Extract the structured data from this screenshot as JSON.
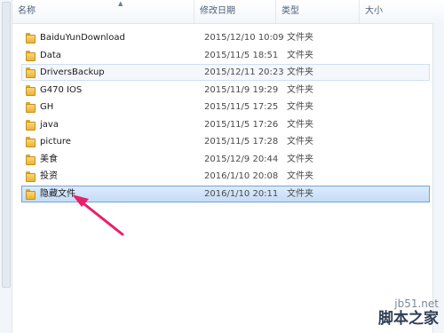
{
  "columns": {
    "name": "名称",
    "date": "修改日期",
    "type": "类型",
    "size": "大小"
  },
  "rows": [
    {
      "name": "BaiduYunDownload",
      "date": "2015/12/10 10:09",
      "type": "文件夹"
    },
    {
      "name": "Data",
      "date": "2015/11/5 18:51",
      "type": "文件夹"
    },
    {
      "name": "DriversBackup",
      "date": "2015/12/11 20:23",
      "type": "文件夹"
    },
    {
      "name": "G470 IOS",
      "date": "2015/11/9 19:29",
      "type": "文件夹"
    },
    {
      "name": "GH",
      "date": "2015/11/5 17:25",
      "type": "文件夹"
    },
    {
      "name": "java",
      "date": "2015/11/5 17:26",
      "type": "文件夹"
    },
    {
      "name": "picture",
      "date": "2015/11/5 17:28",
      "type": "文件夹"
    },
    {
      "name": "美食",
      "date": "2015/12/9 20:44",
      "type": "文件夹"
    },
    {
      "name": "投资",
      "date": "2016/1/10 20:08",
      "type": "文件夹"
    },
    {
      "name": "隐藏文件",
      "date": "2016/1/10 20:11",
      "type": "文件夹"
    }
  ],
  "hovered_row": 2,
  "selected_row": 9,
  "watermark": {
    "url": "jb51.net",
    "name": "脚本之家"
  },
  "colors": {
    "arrow": "#e8206a",
    "selection": "#c4dcf7"
  }
}
